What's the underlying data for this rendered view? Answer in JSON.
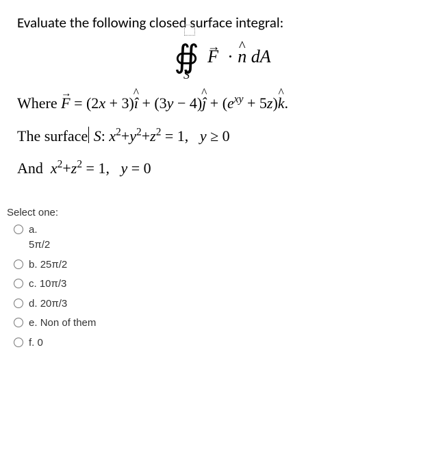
{
  "question": {
    "prompt": "Evaluate the following closed surface integral:",
    "integral_text": "∯_S F · n̂ dA",
    "where_line": "Where F⃗ = (2x + 3)î + (3y − 4)ĵ + (eˣʸ + 5z)k̂.",
    "surface_line": "The surface S: x²+y²+z² = 1,   y ≥ 0",
    "and_line": "And  x²+z² = 1,   y = 0",
    "F_components": {
      "i": "(2x + 3)",
      "j": "(3y − 4)",
      "k": "(eˣʸ + 5z)"
    },
    "surfaces": [
      "x²+y²+z² = 1, y ≥ 0",
      "x²+z² = 1, y = 0"
    ]
  },
  "select_label": "Select one:",
  "options": [
    {
      "key": "a",
      "label_prefix": "a.",
      "value": "5π/2"
    },
    {
      "key": "b",
      "label_prefix": "b.",
      "value": "25π/2"
    },
    {
      "key": "c",
      "label_prefix": "c.",
      "value": "10π/3"
    },
    {
      "key": "d",
      "label_prefix": "d.",
      "value": "20π/3"
    },
    {
      "key": "e",
      "label_prefix": "e.",
      "value": "Non of them"
    },
    {
      "key": "f",
      "label_prefix": "f.",
      "value": "0"
    }
  ]
}
